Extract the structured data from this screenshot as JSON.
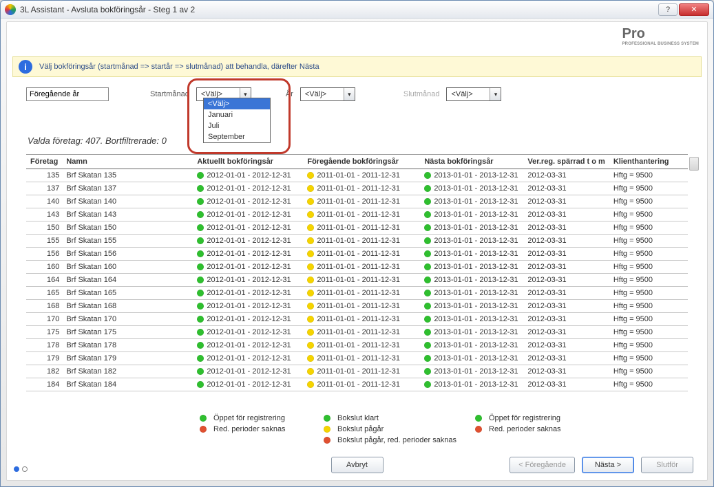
{
  "window": {
    "title": "3L Assistant - Avsluta bokföringsår - Steg 1 av 2"
  },
  "logo": {
    "text": "Pro",
    "sub": "PROFESSIONAL BUSINESS SYSTEM"
  },
  "info_bar": {
    "text": "Välj bokföringsår (startmånad => startår => slutmånad) att behandla, därefter Nästa"
  },
  "filters": {
    "prev_year_value": "Föregående år",
    "start_month_label": "Startmånad",
    "start_month_value": "<Välj>",
    "year_label": "År",
    "year_value": "<Välj>",
    "end_month_label": "Slutmånad",
    "end_month_value": "<Välj>",
    "dropdown_options": [
      "<Välj>",
      "Januari",
      "Juli",
      "September"
    ]
  },
  "summary": "Valda företag: 407. Bortfiltrerade: 0",
  "table": {
    "headers": [
      "Företag",
      "Namn",
      "Aktuellt bokföringsår",
      "Föregående bokföringsår",
      "Nästa bokföringsår",
      "Ver.reg. spärrad t o m",
      "Klienthantering"
    ],
    "current": "2012-01-01 - 2012-12-31",
    "prev": "2011-01-01 - 2011-12-31",
    "next": "2013-01-01 - 2013-12-31",
    "locked": "2012-03-31",
    "klient": "Hftg = 9500",
    "rows": [
      {
        "id": "135",
        "name": "Brf Skatan 135"
      },
      {
        "id": "137",
        "name": "Brf Skatan 137"
      },
      {
        "id": "140",
        "name": "Brf Skatan 140"
      },
      {
        "id": "143",
        "name": "Brf Skatan 143"
      },
      {
        "id": "150",
        "name": "Brf Skatan 150"
      },
      {
        "id": "155",
        "name": "Brf Skatan 155"
      },
      {
        "id": "156",
        "name": "Brf Skatan 156"
      },
      {
        "id": "160",
        "name": "Brf Skatan 160"
      },
      {
        "id": "164",
        "name": "Brf Skatan 164"
      },
      {
        "id": "165",
        "name": "Brf Skatan 165"
      },
      {
        "id": "168",
        "name": "Brf Skatan 168"
      },
      {
        "id": "170",
        "name": "Brf Skatan 170"
      },
      {
        "id": "175",
        "name": "Brf Skatan 175"
      },
      {
        "id": "178",
        "name": "Brf Skatan 178"
      },
      {
        "id": "179",
        "name": "Brf Skatan 179"
      },
      {
        "id": "182",
        "name": "Brf Skatan 182"
      },
      {
        "id": "184",
        "name": "Brf Skatan 184"
      }
    ]
  },
  "legend": {
    "l1": "Öppet för registrering",
    "l2": "Bokslut klart",
    "l3": "Öppet för registrering",
    "l4": "Red. perioder saknas",
    "l5": "Bokslut pågår",
    "l6": "Red. perioder saknas",
    "l7": "Bokslut pågår, red. perioder saknas"
  },
  "buttons": {
    "cancel": "Avbryt",
    "prev": "< Föregående",
    "next": "Nästa >",
    "finish": "Slutför"
  }
}
